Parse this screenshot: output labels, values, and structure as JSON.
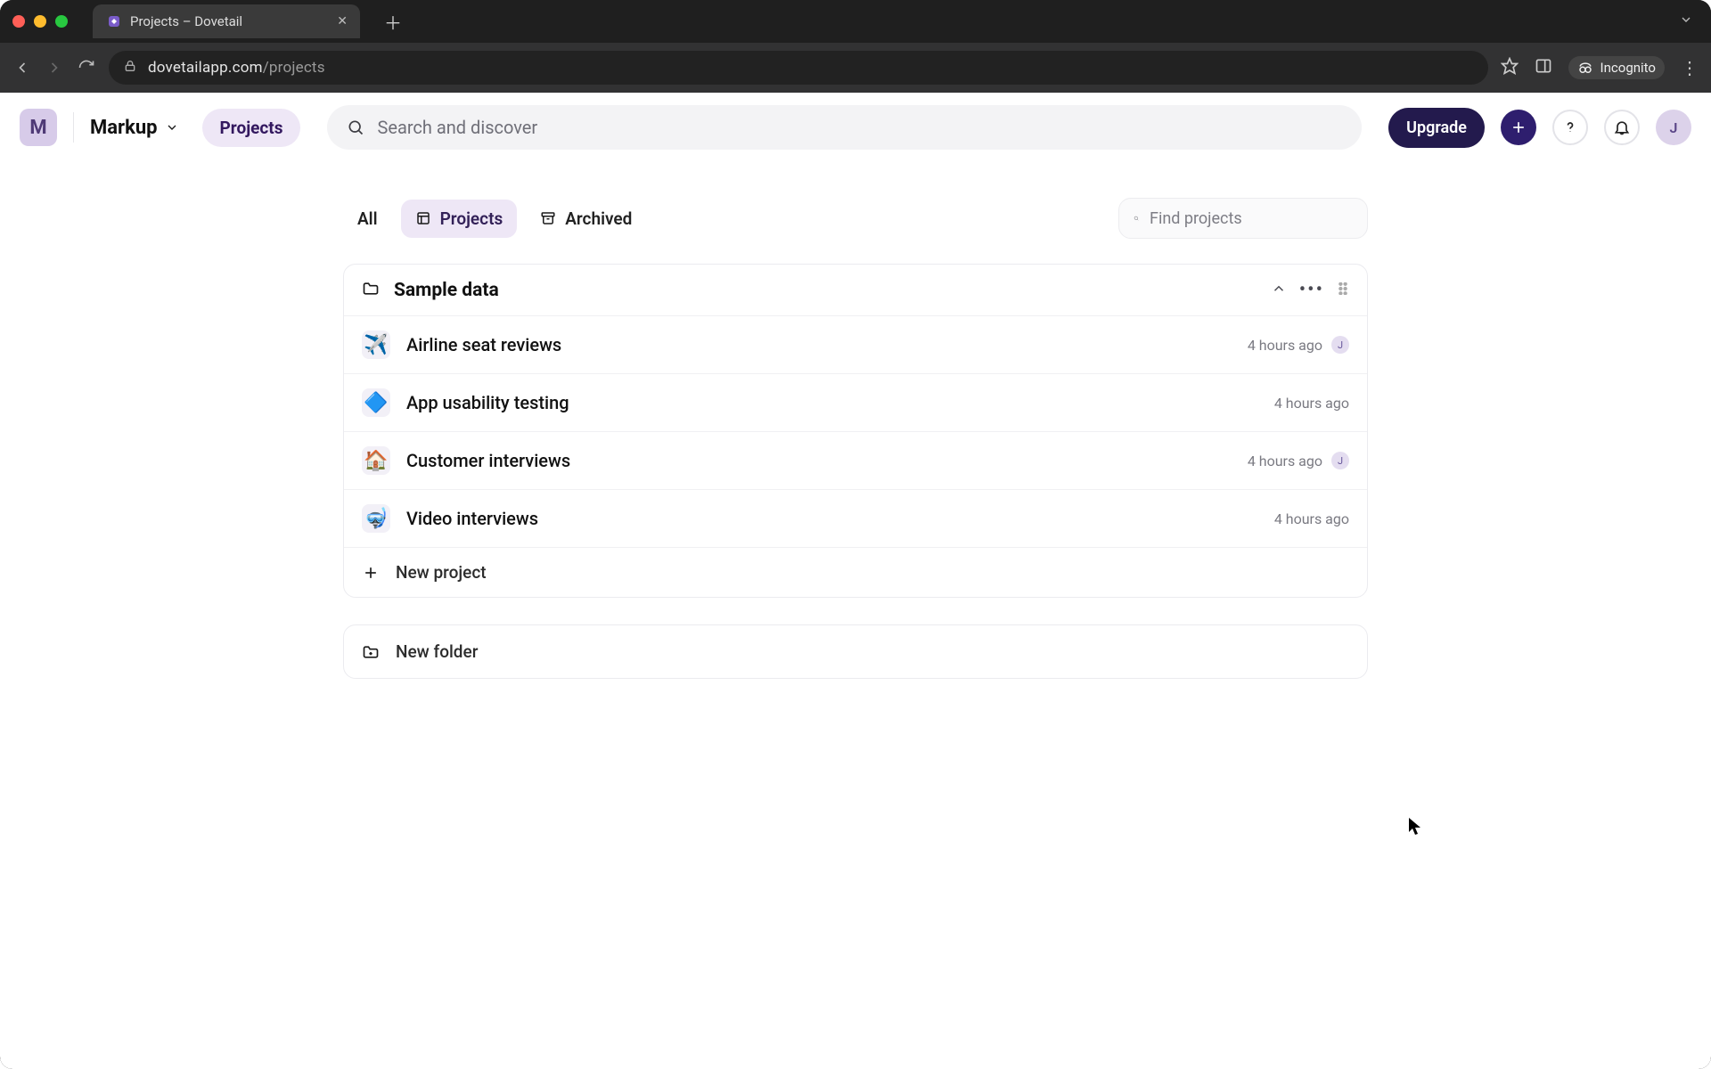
{
  "browser": {
    "tab_title": "Projects – Dovetail",
    "url_host": "dovetailapp.com",
    "url_path": "/projects",
    "incognito_label": "Incognito"
  },
  "header": {
    "workspace_initial": "M",
    "workspace_name": "Markup",
    "projects_label": "Projects",
    "search_placeholder": "Search and discover",
    "upgrade_label": "Upgrade",
    "user_initial": "J"
  },
  "tabs": {
    "all": "All",
    "projects": "Projects",
    "archived": "Archived",
    "find_placeholder": "Find projects"
  },
  "folder": {
    "title": "Sample data",
    "projects": [
      {
        "emoji": "✈️",
        "name": "Airline seat reviews",
        "time": "4 hours ago",
        "has_viewer": true,
        "viewer_initial": "J"
      },
      {
        "emoji": "🔷",
        "name": "App usability testing",
        "time": "4 hours ago",
        "has_viewer": false,
        "viewer_initial": ""
      },
      {
        "emoji": "🏠",
        "name": "Customer interviews",
        "time": "4 hours ago",
        "has_viewer": true,
        "viewer_initial": "J"
      },
      {
        "emoji": "🤿",
        "name": "Video interviews",
        "time": "4 hours ago",
        "has_viewer": false,
        "viewer_initial": ""
      }
    ]
  },
  "actions": {
    "new_project": "New project",
    "new_folder": "New folder"
  }
}
